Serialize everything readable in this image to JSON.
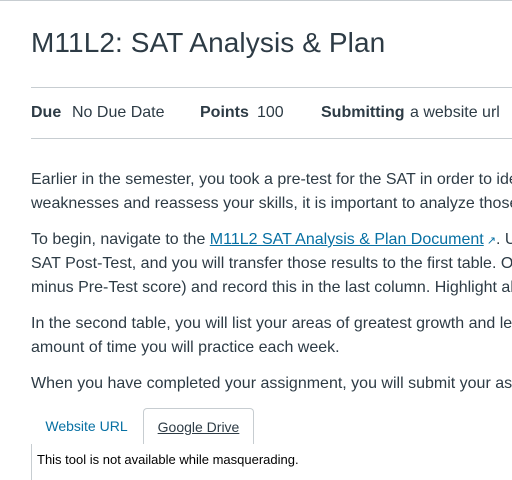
{
  "assignment": {
    "title": "M11L2: SAT Analysis & Plan"
  },
  "details": {
    "due_label": "Due",
    "due_value": "No Due Date",
    "points_label": "Points",
    "points_value": "100",
    "submitting_label": "Submitting",
    "submitting_value": "a website url"
  },
  "description": {
    "p1_line1": "Earlier in the semester, you took a pre-test for the SAT in order to ide",
    "p1_line2": "weaknesses and reassess your skills, it is important to analyze those r",
    "p2_prefix": "To begin, navigate to the ",
    "p2_link": "M11L2 SAT Analysis & Plan Document",
    "p2_suffix": ". U",
    "p2_line2": "SAT Post-Test, and you will transfer those results to the first table. Or",
    "p2_line3": "minus Pre-Test score) and record this in the last column. Highlight all p",
    "p3_line1": "In the second table, you will list your areas of greatest growth and lea",
    "p3_line2": "amount of time you will practice each week.",
    "p4_line1": "When you have completed your assignment, you will submit your ass"
  },
  "submission": {
    "tabs": [
      "Website URL",
      "Google Drive"
    ],
    "active_tab": "Google Drive",
    "panel_message": "This tool is not available while masquerading."
  },
  "colors": {
    "text": "#2d3b45",
    "link": "#0770a3",
    "border": "#c7cdd1"
  }
}
